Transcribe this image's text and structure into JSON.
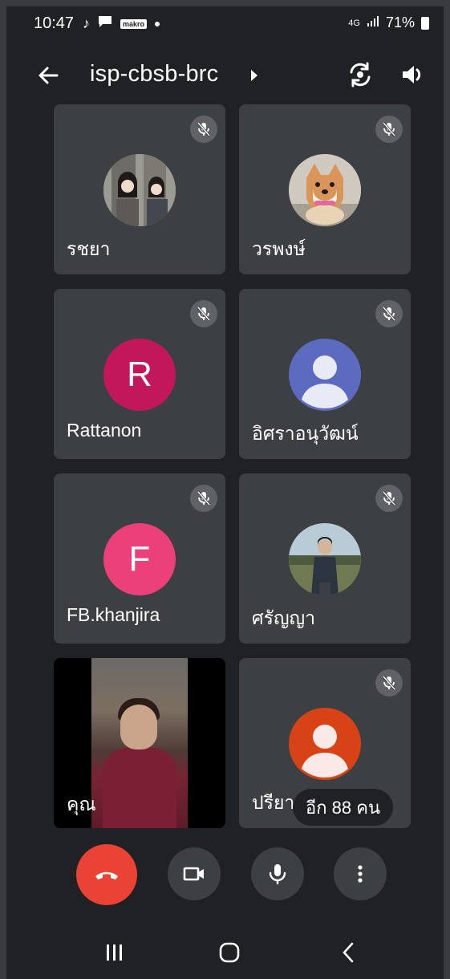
{
  "status_bar": {
    "time": "10:47",
    "notif_label": "makro",
    "network": "4G",
    "battery": "71%"
  },
  "top_bar": {
    "title": "isp-cbsb-brc"
  },
  "tiles": [
    {
      "name": "รชยา",
      "avatar_type": "photo",
      "muted": true
    },
    {
      "name": "วรพงษ์",
      "avatar_type": "photo",
      "muted": true
    },
    {
      "name": "Rattanon",
      "avatar_type": "letter",
      "letter": "R",
      "color": "#c2185b",
      "muted": true
    },
    {
      "name": "อิศราอนุวัฒน์",
      "avatar_type": "default",
      "color": "#5c6bc0",
      "muted": true
    },
    {
      "name": "FB.khanjira",
      "avatar_type": "letter",
      "letter": "F",
      "color": "#ec407a",
      "muted": true
    },
    {
      "name": "ศรัญญา",
      "avatar_type": "photo",
      "muted": true
    },
    {
      "name": "คุณ",
      "avatar_type": "video",
      "muted": false
    },
    {
      "name": "ปรียา",
      "avatar_type": "default",
      "color": "#d84315",
      "muted": true
    }
  ],
  "more_participants": "อีก 88 คน",
  "controls": {
    "end_call_color": "#ea4335",
    "buttons": [
      "end-call",
      "camera",
      "microphone",
      "more-options"
    ]
  },
  "colors": {
    "background": "#202124",
    "tile": "#3c4043",
    "mute_badge": "#5f6368"
  }
}
